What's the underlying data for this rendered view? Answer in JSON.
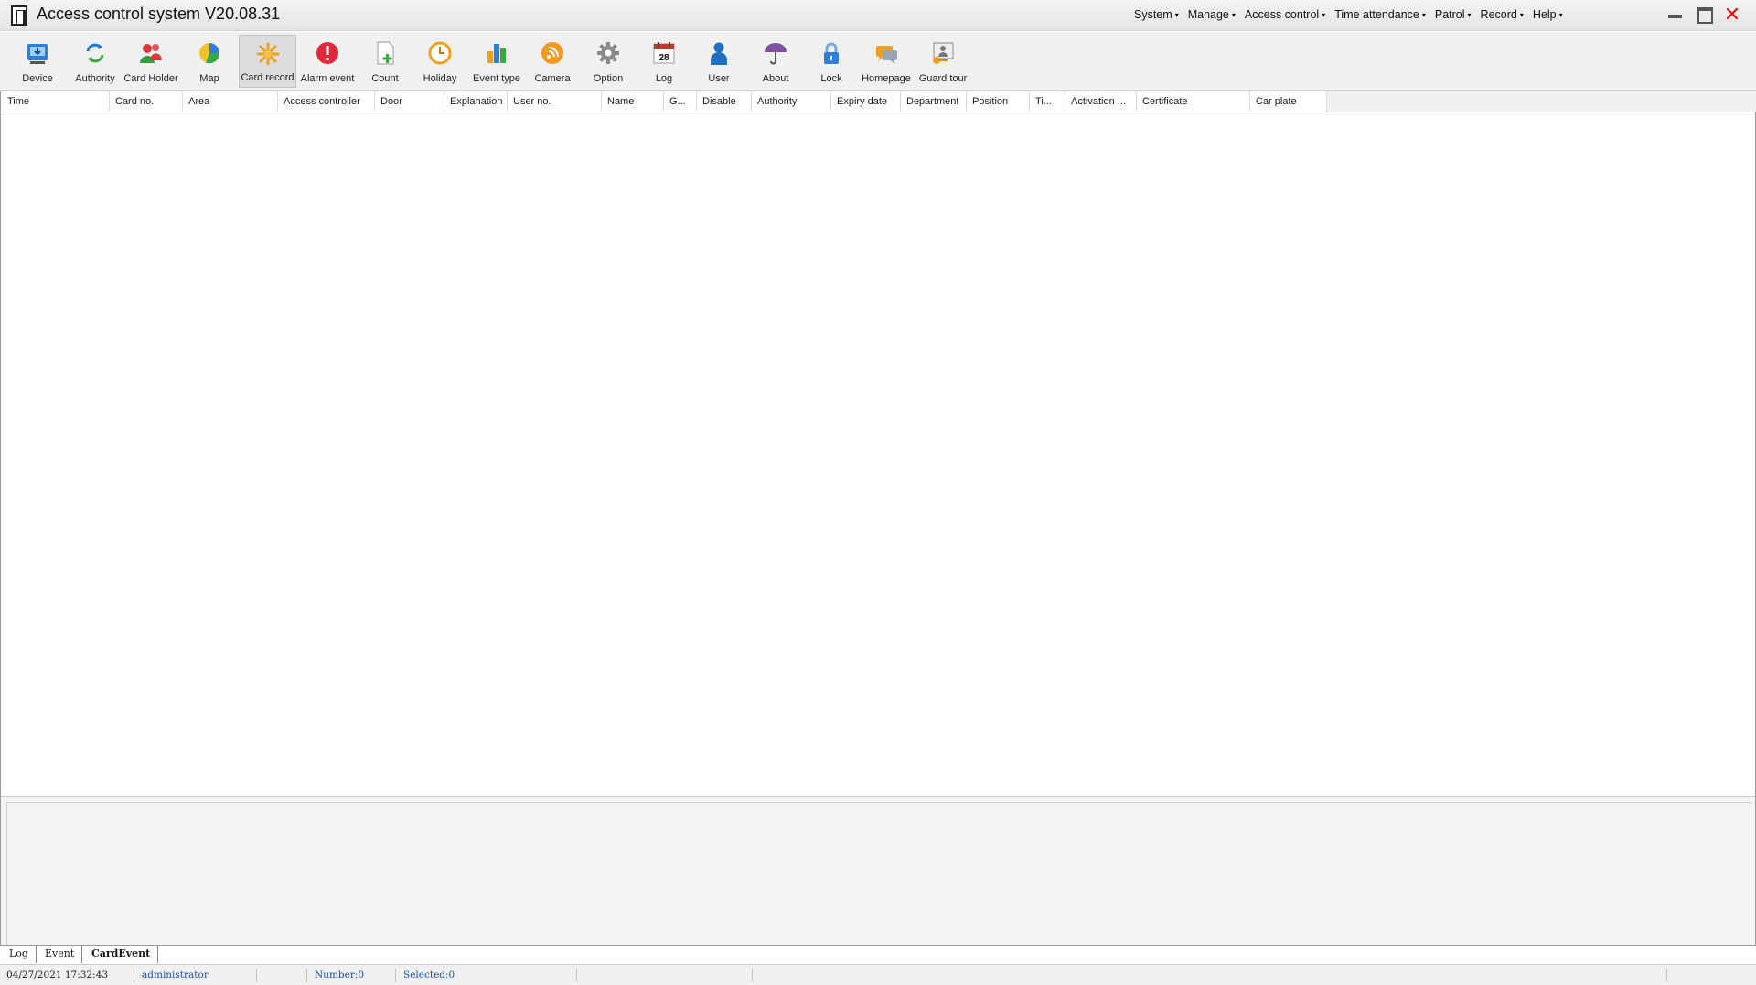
{
  "app": {
    "title": "Access control system V20.08.31"
  },
  "menu": [
    "System",
    "Manage",
    "Access control",
    "Time attendance",
    "Patrol",
    "Record",
    "Help"
  ],
  "menu_caret": "▾",
  "window": {
    "close_glyph": "✕"
  },
  "toolbar": [
    {
      "label": "Device",
      "icon": "device-icon"
    },
    {
      "label": "Authority",
      "icon": "authority-icon"
    },
    {
      "label": "Card Holder",
      "icon": "card-holder-icon"
    },
    {
      "label": "Map",
      "icon": "map-icon"
    },
    {
      "label": "Card record",
      "icon": "card-record-icon",
      "active": true
    },
    {
      "label": "Alarm event",
      "icon": "alarm-event-icon"
    },
    {
      "label": "Count",
      "icon": "count-icon"
    },
    {
      "label": "Holiday",
      "icon": "holiday-icon"
    },
    {
      "label": "Event type",
      "icon": "event-type-icon"
    },
    {
      "label": "Camera",
      "icon": "camera-icon"
    },
    {
      "label": "Option",
      "icon": "option-icon"
    },
    {
      "label": "Log",
      "icon": "log-icon",
      "badge": "28"
    },
    {
      "label": "User",
      "icon": "user-icon"
    },
    {
      "label": "About",
      "icon": "about-icon"
    },
    {
      "label": "Lock",
      "icon": "lock-icon"
    },
    {
      "label": "Homepage",
      "icon": "homepage-icon"
    },
    {
      "label": "Guard tour",
      "icon": "guard-tour-icon"
    }
  ],
  "table": {
    "columns": [
      "Time",
      "Card no.",
      "Area",
      "Access controller",
      "Door",
      "Explanation",
      "User no.",
      "Name",
      "G...",
      "Disable",
      "Authority",
      "Expiry date",
      "Department",
      "Position",
      "Ti...",
      "Activation ...",
      "Certificate",
      "Car plate"
    ],
    "rows": []
  },
  "tabs": [
    {
      "label": "Log"
    },
    {
      "label": "Event"
    },
    {
      "label": "CardEvent",
      "selected": true
    }
  ],
  "status": {
    "datetime": "04/27/2021 17:32:43",
    "user": "administrator",
    "number": "Number:0",
    "selected": "Selected:0"
  }
}
